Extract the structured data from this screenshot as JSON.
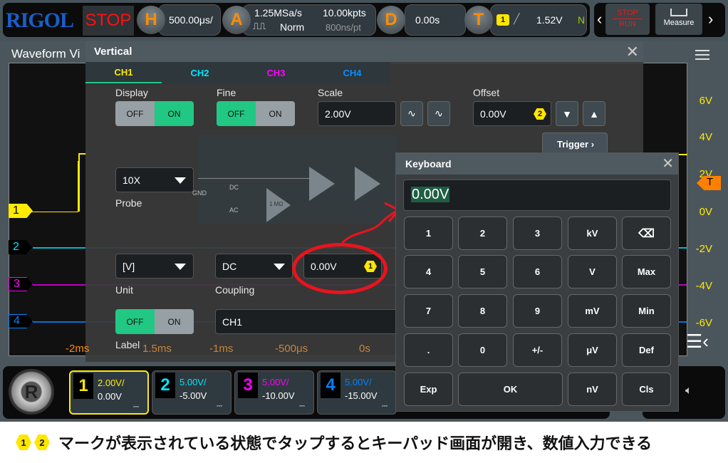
{
  "topbar": {
    "brand": "RIGOL",
    "run_state": "STOP",
    "horizontal": {
      "key": "H",
      "timebase": "500.00μs/"
    },
    "acquire": {
      "key": "A",
      "sample_rate": "1.25MSa/s",
      "mode": "Norm",
      "memory_depth": "10.00kpts",
      "resolution": "800ns/pt"
    },
    "delay": {
      "key": "D",
      "value": "0.00s"
    },
    "trigger": {
      "key": "T",
      "source": "1",
      "level": "1.52V",
      "status": "N"
    },
    "stop_run": {
      "stop": "STOP",
      "run": "RUN"
    },
    "measure": "Measure"
  },
  "waveform": {
    "title": "Waveform Vi",
    "y_labels": [
      "6V",
      "4V",
      "2V",
      "0V",
      "-2V",
      "-4V",
      "-6V"
    ],
    "x_labels": [
      "-2ms",
      "1.5ms",
      "-1ms",
      "-500μs",
      "0s"
    ],
    "trigger_marker": "T",
    "channels": [
      {
        "n": "1",
        "color": "#ffea00"
      },
      {
        "n": "2",
        "color": "#00e5ff"
      },
      {
        "n": "3",
        "color": "#ff00ff"
      },
      {
        "n": "4",
        "color": "#0080ff"
      }
    ]
  },
  "vertical": {
    "title": "Vertical",
    "tabs": [
      "CH1",
      "CH2",
      "CH3",
      "CH4"
    ],
    "active_tab": "CH1",
    "display": {
      "label": "Display",
      "off": "OFF",
      "on": "ON",
      "value": "ON"
    },
    "fine": {
      "label": "Fine",
      "off": "OFF",
      "on": "ON",
      "value": "OFF"
    },
    "scale": {
      "label": "Scale",
      "value": "2.00V"
    },
    "offset": {
      "label": "Offset",
      "value": "0.00V",
      "badge": "2"
    },
    "trigger_btn": "Trigger",
    "probe": {
      "label": "Probe",
      "value": "10X"
    },
    "diagram": {
      "gnd": "GND",
      "dc": "DC",
      "ac": "AC",
      "impedance": "1 MΩ"
    },
    "unit": {
      "label": "Unit",
      "value": "[V]"
    },
    "coupling": {
      "label": "Coupling",
      "value": "DC"
    },
    "bias": {
      "value": "0.00V",
      "badge": "1"
    },
    "label": {
      "label": "Label",
      "off": "OFF",
      "on": "ON",
      "value": "OFF",
      "text": "CH1"
    }
  },
  "keyboard": {
    "title": "Keyboard",
    "input": "0.00V",
    "keys": [
      [
        "1",
        "2",
        "3",
        "kV",
        "⌫"
      ],
      [
        "4",
        "5",
        "6",
        "V",
        "Max"
      ],
      [
        "7",
        "8",
        "9",
        "mV",
        "Min"
      ],
      [
        ".",
        "0",
        "+/-",
        "μV",
        "Def"
      ],
      [
        "Exp",
        "OK",
        "nV",
        "Cls"
      ]
    ]
  },
  "bottom": {
    "channels": [
      {
        "n": "1",
        "scale": "2.00V/",
        "offset": "0.00V",
        "color": "#ffea00"
      },
      {
        "n": "2",
        "scale": "5.00V/",
        "offset": "-5.00V",
        "color": "#00e5ff"
      },
      {
        "n": "3",
        "scale": "5.00V/",
        "offset": "-10.00V",
        "color": "#ff00ff"
      },
      {
        "n": "4",
        "scale": "5.00V/",
        "offset": "-15.00V",
        "color": "#0080ff"
      }
    ],
    "coupling_symbol": "⎓"
  },
  "caption": {
    "badges": [
      "1",
      "2"
    ],
    "text": "マークが表示されている状態でタップするとキーパッド画面が開き、数値入力できる"
  }
}
